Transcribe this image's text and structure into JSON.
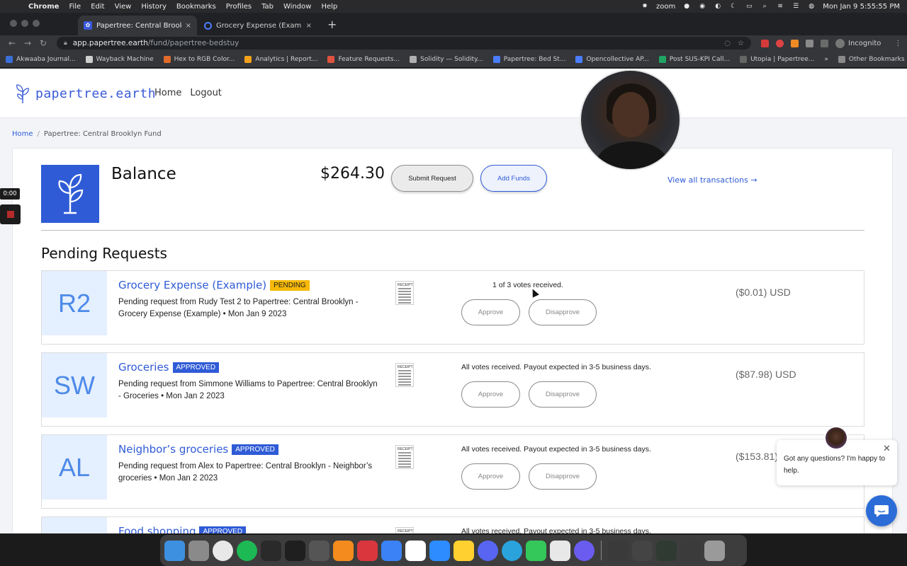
{
  "menubar": {
    "app": "Chrome",
    "items": [
      "File",
      "Edit",
      "View",
      "History",
      "Bookmarks",
      "Profiles",
      "Tab",
      "Window",
      "Help"
    ],
    "zoom": "zoom",
    "clock": "Mon Jan 9  5:55:55 PM"
  },
  "tabs": [
    {
      "label": "Papertree: Central Brooklyn Fu",
      "close": "×"
    },
    {
      "label": "Grocery Expense (Example) · E",
      "close": "×"
    }
  ],
  "newtab": "+",
  "address": {
    "host": "app.papertree.earth",
    "path": "/fund/papertree-bedstuy"
  },
  "profile": {
    "label": "Incognito"
  },
  "bookmarks": [
    {
      "label": "Akwaaba Journal...",
      "color": "#3b6fd8"
    },
    {
      "label": "Wayback Machine",
      "color": "#cfcfcf"
    },
    {
      "label": "Hex to RGB Color...",
      "color": "#e06b2a"
    },
    {
      "label": "Analytics | Report...",
      "color": "#f4a21c"
    },
    {
      "label": "Feature Requests...",
      "color": "#e0533f"
    },
    {
      "label": "Solidity — Solidity...",
      "color": "#b0b0b0"
    },
    {
      "label": "Papertree: Bed St...",
      "color": "#4a7dff"
    },
    {
      "label": "Opencollective AP...",
      "color": "#4a7dff"
    },
    {
      "label": "Post SUS-KPI Call...",
      "color": "#1fa463"
    },
    {
      "label": "Utopia | Papertree...",
      "color": "#666666"
    }
  ],
  "bookmarks_more": "»",
  "bookmarks_other": "Other Bookmarks",
  "site": {
    "logo_text": "papertree.earth",
    "nav": [
      "Home",
      "Logout"
    ]
  },
  "breadcrumb": {
    "home": "Home",
    "sep": "/",
    "current": "Papertree: Central Brooklyn Fund"
  },
  "fund": {
    "title": "Balance",
    "amount": "$264.30",
    "submit_label": "Submit Request",
    "add_funds_label": "Add Funds",
    "view_all": "View all transactions →"
  },
  "pending": {
    "title": "Pending Requests",
    "approve_label": "Approve",
    "disapprove_label": "Disapprove",
    "receipt_label": "RECEIPT",
    "items": [
      {
        "initials": "R2",
        "title": "Grocery Expense (Example)",
        "status": "PENDING",
        "desc": "Pending request from Rudy Test 2 to Papertree: Central Brooklyn - Grocery Expense (Example) • Mon Jan 9 2023",
        "votes": "1 of 3 votes received.",
        "amount": "($0.01) USD"
      },
      {
        "initials": "SW",
        "title": "Groceries",
        "status": "APPROVED",
        "desc": "Pending request from Simmone Williams to Papertree: Central Brooklyn - Groceries • Mon Jan 2 2023",
        "votes": "All votes received. Payout expected in 3-5 business days.",
        "amount": "($87.98) USD"
      },
      {
        "initials": "AL",
        "title": "Neighbor’s groceries",
        "status": "APPROVED",
        "desc": "Pending request from Alex to Papertree: Central Brooklyn - Neighbor’s groceries • Mon Jan 2 2023",
        "votes": "All votes received. Payout expected in 3-5 business days.",
        "amount": "($153.81)"
      },
      {
        "initials": "",
        "title": "Food shopping",
        "status": "APPROVED",
        "desc": "",
        "votes": "All votes received. Payout expected in 3-5 business days.",
        "amount": ""
      }
    ]
  },
  "recording": {
    "time": "0:00"
  },
  "chat": {
    "message": "Got any questions? I'm happy to help.",
    "close": "✕"
  },
  "dock": [
    {
      "name": "finder",
      "color": "#3d8fe0"
    },
    {
      "name": "system-settings",
      "color": "#8a8a8a"
    },
    {
      "name": "chrome",
      "color": "#e8e8e8"
    },
    {
      "name": "spotify",
      "color": "#1db954"
    },
    {
      "name": "activity-monitor",
      "color": "#2a2a2a"
    },
    {
      "name": "terminal",
      "color": "#1f1f1f"
    },
    {
      "name": "calculator",
      "color": "#555555"
    },
    {
      "name": "sublime-text",
      "color": "#f38b1e"
    },
    {
      "name": "cobra",
      "color": "#d9363e"
    },
    {
      "name": "toggl",
      "color": "#3b82f6"
    },
    {
      "name": "slack",
      "color": "#ffffff"
    },
    {
      "name": "zoom",
      "color": "#2d8cff"
    },
    {
      "name": "miro",
      "color": "#ffd02f"
    },
    {
      "name": "discord",
      "color": "#5865f2"
    },
    {
      "name": "telegram",
      "color": "#2aa3dd"
    },
    {
      "name": "messages",
      "color": "#34c759"
    },
    {
      "name": "acrobat",
      "color": "#e8e8e8"
    },
    {
      "name": "app",
      "color": "#6b5cf0"
    },
    {
      "name": "window-1",
      "color": "#3a3a3a"
    },
    {
      "name": "window-2",
      "color": "#444444"
    },
    {
      "name": "window-3",
      "color": "#2f3a33"
    },
    {
      "name": "window-4",
      "color": "#3b3b3b"
    },
    {
      "name": "trash",
      "color": "#9a9a9a"
    }
  ],
  "colors": {
    "brand": "#2f5bd6",
    "pending": "#f6b908",
    "avatar_bg": "#e4efff"
  }
}
